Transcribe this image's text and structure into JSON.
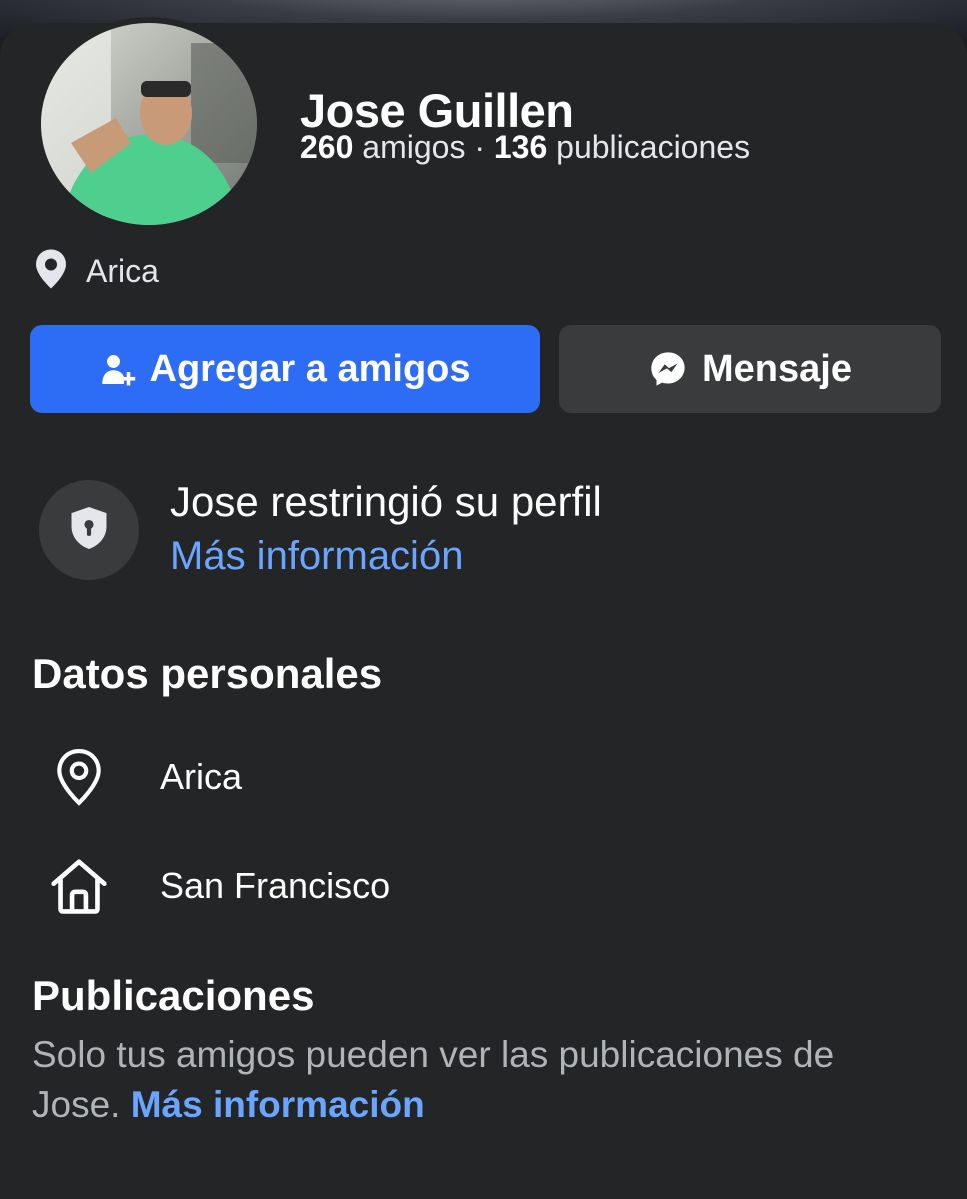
{
  "profile": {
    "name": "Jose Guillen",
    "friends_count": "260",
    "friends_label": "amigos",
    "separator": "·",
    "posts_count": "136",
    "posts_label": "publicaciones",
    "location": "Arica"
  },
  "actions": {
    "add_friend_label": "Agregar a amigos",
    "message_label": "Mensaje"
  },
  "restriction": {
    "title": "Jose restringió su perfil",
    "link": "Más información"
  },
  "personal": {
    "title": "Datos personales",
    "items": [
      {
        "icon": "location-pin-outline-icon",
        "label": "Arica"
      },
      {
        "icon": "home-icon",
        "label": "San Francisco"
      }
    ]
  },
  "posts": {
    "title": "Publicaciones",
    "text": "Solo tus amigos pueden ver las publicaciones de Jose.",
    "link": "Más información"
  },
  "colors": {
    "background": "#242526",
    "primary_button": "#2d6cf5",
    "secondary_button": "#3a3b3c",
    "link": "#6aa5ff"
  }
}
